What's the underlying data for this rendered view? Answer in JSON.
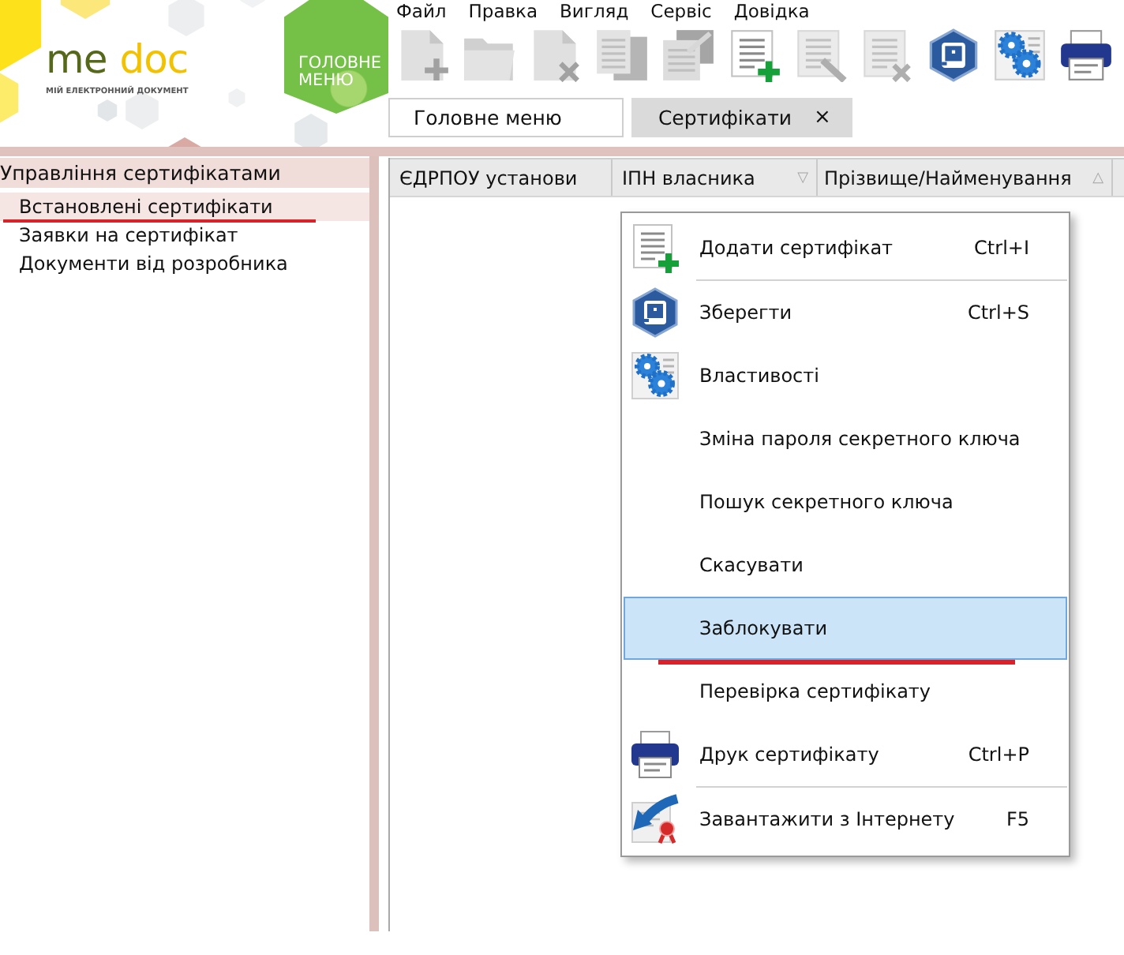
{
  "header": {
    "logo": {
      "wordmark": [
        "me",
        "doc"
      ],
      "tagline": "МІЙ ЕЛЕКТРОННИЙ ДОКУМЕНТ"
    },
    "main_menu_button": "ГОЛОВНЕ МЕНЮ"
  },
  "menu_bar": [
    "Файл",
    "Правка",
    "Вигляд",
    "Сервіс",
    "Довідка"
  ],
  "toolbar": [
    {
      "kind": "page-plus",
      "disabled": true
    },
    {
      "kind": "folder",
      "disabled": true
    },
    {
      "kind": "page-cross",
      "disabled": true
    },
    {
      "kind": "copy-pages",
      "disabled": true
    },
    {
      "kind": "page-arrow",
      "disabled": true
    },
    {
      "kind": "list-plus",
      "disabled": false
    },
    {
      "kind": "list-pencil",
      "disabled": true
    },
    {
      "kind": "list-cross",
      "disabled": true
    },
    {
      "kind": "save",
      "disabled": false
    },
    {
      "kind": "gears",
      "disabled": false
    },
    {
      "kind": "printer",
      "disabled": false
    }
  ],
  "tabs": [
    {
      "label": "Головне меню",
      "selected": false
    },
    {
      "label": "Сертифікати",
      "selected": true,
      "close": "×"
    }
  ],
  "sidebar": {
    "title": "Управління сертифікатами",
    "items": [
      {
        "label": "Встановлені сертифікати",
        "selected": true,
        "underlined": true
      },
      {
        "label": "Заявки на сертифікат",
        "selected": false,
        "underlined": false
      },
      {
        "label": "Документи від розробника",
        "selected": false,
        "underlined": false
      }
    ]
  },
  "table": {
    "columns": [
      {
        "label": "ЄДРПОУ установи"
      },
      {
        "label": "ІПН власника",
        "sort_glyph": "▽"
      },
      {
        "label": "Прізвище/Найменування",
        "sort_glyph": "△"
      }
    ]
  },
  "context_menu": {
    "items": [
      {
        "kind": "list-plus",
        "label": "Додати сертифікат",
        "shortcut": "Ctrl+I",
        "selected": false,
        "underlined": false,
        "separator_after": true
      },
      {
        "kind": "save",
        "label": "Зберегти",
        "shortcut": "Ctrl+S",
        "selected": false,
        "underlined": false,
        "separator_after": false
      },
      {
        "kind": "gears",
        "label": "Властивості",
        "selected": false,
        "underlined": false,
        "separator_after": false
      },
      {
        "kind": "plain",
        "label": "Зміна пароля секретного ключа",
        "selected": false,
        "underlined": false,
        "separator_after": false
      },
      {
        "kind": "plain",
        "label": "Пошук секретного ключа",
        "selected": false,
        "underlined": false,
        "separator_after": false
      },
      {
        "kind": "plain",
        "label": "Скасувати",
        "selected": false,
        "underlined": false,
        "separator_after": false
      },
      {
        "kind": "plain",
        "label": "Заблокувати",
        "selected": true,
        "underlined": true,
        "separator_after": false
      },
      {
        "kind": "plain",
        "label": "Перевірка сертифікату",
        "selected": false,
        "underlined": false,
        "separator_after": false
      },
      {
        "kind": "printer",
        "label": "Друк сертифікату",
        "shortcut": "Ctrl+P",
        "selected": false,
        "underlined": false,
        "separator_after": true
      },
      {
        "kind": "arrow-badge",
        "label": "Завантажити з Інтернету",
        "shortcut": "F5",
        "selected": false,
        "underlined": false,
        "separator_after": false
      }
    ]
  }
}
